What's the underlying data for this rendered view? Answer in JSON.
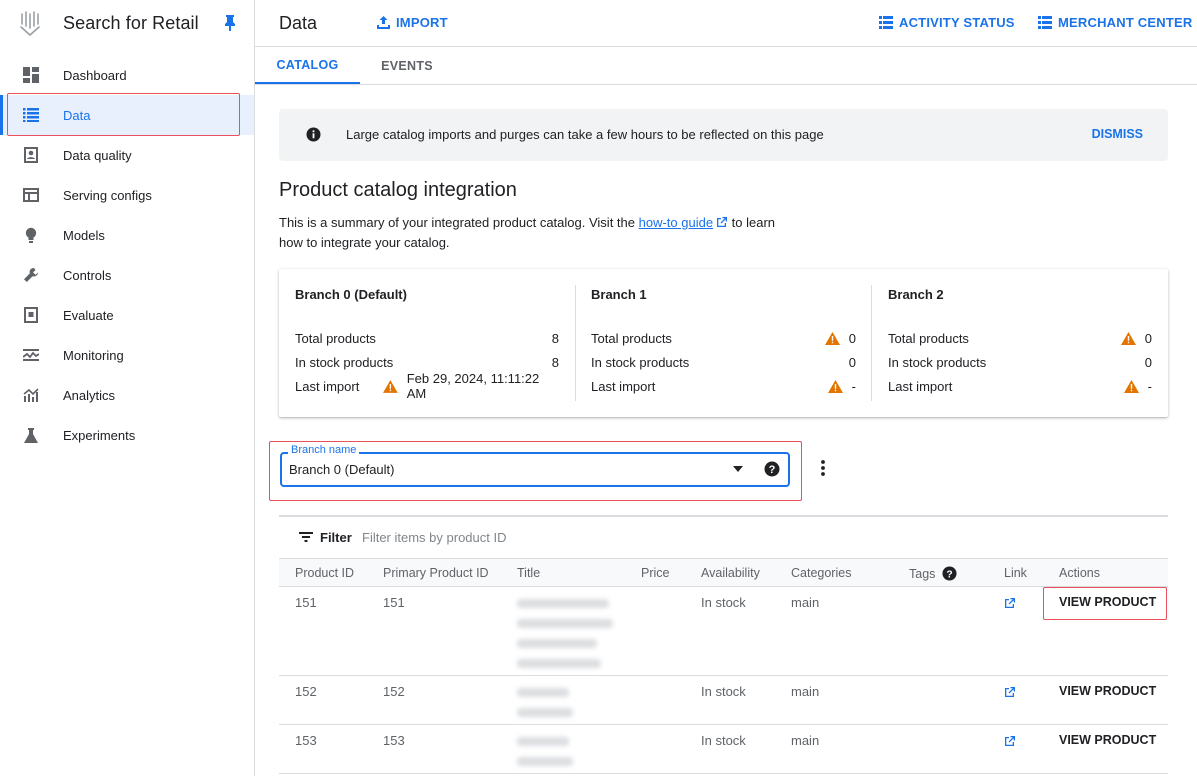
{
  "app": {
    "title": "Search for Retail"
  },
  "sidebar": {
    "items": [
      {
        "label": "Dashboard",
        "icon": "dashboard-icon"
      },
      {
        "label": "Data",
        "icon": "list-icon",
        "active": true
      },
      {
        "label": "Data quality",
        "icon": "data-quality-icon"
      },
      {
        "label": "Serving configs",
        "icon": "serving-configs-icon"
      },
      {
        "label": "Models",
        "icon": "lightbulb-icon"
      },
      {
        "label": "Controls",
        "icon": "wrench-icon"
      },
      {
        "label": "Evaluate",
        "icon": "evaluate-icon"
      },
      {
        "label": "Monitoring",
        "icon": "monitoring-icon"
      },
      {
        "label": "Analytics",
        "icon": "analytics-icon"
      },
      {
        "label": "Experiments",
        "icon": "flask-icon"
      }
    ]
  },
  "header": {
    "title": "Data",
    "import_label": "IMPORT",
    "activity_label": "ACTIVITY STATUS",
    "merchant_label": "MERCHANT CENTER"
  },
  "tabs": [
    {
      "label": "CATALOG",
      "active": true
    },
    {
      "label": "EVENTS",
      "active": false
    }
  ],
  "banner": {
    "message": "Large catalog imports and purges can take a few hours to be reflected on this page",
    "dismiss_label": "DISMISS"
  },
  "section": {
    "title": "Product catalog integration",
    "desc_before": "This is a summary of your integrated product catalog. Visit the ",
    "link_text": "how-to guide",
    "desc_after": " to learn how to integrate your catalog."
  },
  "branches": [
    {
      "title": "Branch 0 (Default)",
      "total_label": "Total products",
      "total": "8",
      "total_warn": false,
      "stock_label": "In stock products",
      "stock": "8",
      "import_label": "Last import",
      "last_import": "Feb 29, 2024, 11:11:22 AM",
      "import_warn": true
    },
    {
      "title": "Branch 1",
      "total_label": "Total products",
      "total": "0",
      "total_warn": true,
      "stock_label": "In stock products",
      "stock": "0",
      "import_label": "Last import",
      "last_import": "-",
      "import_warn": true
    },
    {
      "title": "Branch 2",
      "total_label": "Total products",
      "total": "0",
      "total_warn": true,
      "stock_label": "In stock products",
      "stock": "0",
      "import_label": "Last import",
      "last_import": "-",
      "import_warn": true
    }
  ],
  "branch_select": {
    "label": "Branch name",
    "value": "Branch 0 (Default)"
  },
  "filter": {
    "label": "Filter",
    "placeholder": "Filter items by product ID"
  },
  "table": {
    "columns": [
      "Product ID",
      "Primary Product ID",
      "Title",
      "Price",
      "Availability",
      "Categories",
      "Tags",
      "Link",
      "Actions"
    ],
    "rows": [
      {
        "product_id": "151",
        "primary_id": "151",
        "availability": "In stock",
        "categories": "main",
        "action": "VIEW PRODUCT"
      },
      {
        "product_id": "152",
        "primary_id": "152",
        "availability": "In stock",
        "categories": "main",
        "action": "VIEW PRODUCT"
      },
      {
        "product_id": "153",
        "primary_id": "153",
        "availability": "In stock",
        "categories": "main",
        "action": "VIEW PRODUCT"
      }
    ]
  },
  "colors": {
    "accent": "#1a73e8",
    "warning": "#e37400",
    "highlight": "#e8505b"
  }
}
